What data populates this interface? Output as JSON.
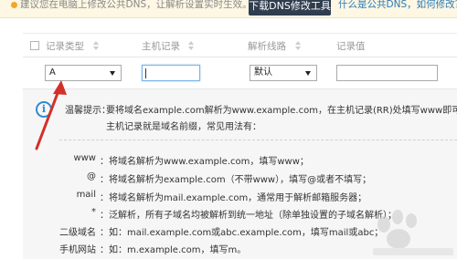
{
  "notice": {
    "text": "建议您在电脑上修改公共DNS，让解析设置实时生效。",
    "button_label": "下载DNS修改工具",
    "link_text": "什么是公共DNS，如何修改？"
  },
  "table": {
    "columns": [
      "记录类型",
      "主机记录",
      "解析线路",
      "记录值"
    ],
    "row": {
      "record_type": "A",
      "host_value": "",
      "line": "默认",
      "record_value": ""
    }
  },
  "tip": {
    "label": "温馨提示：",
    "line1": "要将域名example.com解析为www.example.com，在主机记录(RR)处填写www即可。",
    "line2": "主机记录就是域名前缀，常见用法有："
  },
  "examples": [
    {
      "key": "www",
      "value": "：将域名解析为www.example.com，填写www；"
    },
    {
      "key": "@",
      "value": "：将域名解析为example.com（不带www），填写@或者不填写；"
    },
    {
      "key": "mail",
      "value": "：将域名解析为mail.example.com，通常用于解析邮箱服务器；"
    },
    {
      "key": "*",
      "value": "：泛解析，所有子域名均被解析到统一地址（除单独设置的子域名解析）；"
    },
    {
      "key": "二级域名",
      "value": "：如：mail.example.com或abc.example.com，填写mail或abc；"
    },
    {
      "key": "手机网站",
      "value": "：如：m.example.com，填写m。"
    }
  ],
  "icons": {
    "info": "info-icon",
    "arrow": "red-arrow-annotation",
    "sort": "sort-icon",
    "caret": "chevron-down-icon"
  },
  "colors": {
    "accent": "#2d8ccf",
    "button_bg": "#2f3d4e",
    "link": "#2a7ab8",
    "arrow": "#d2302a"
  }
}
